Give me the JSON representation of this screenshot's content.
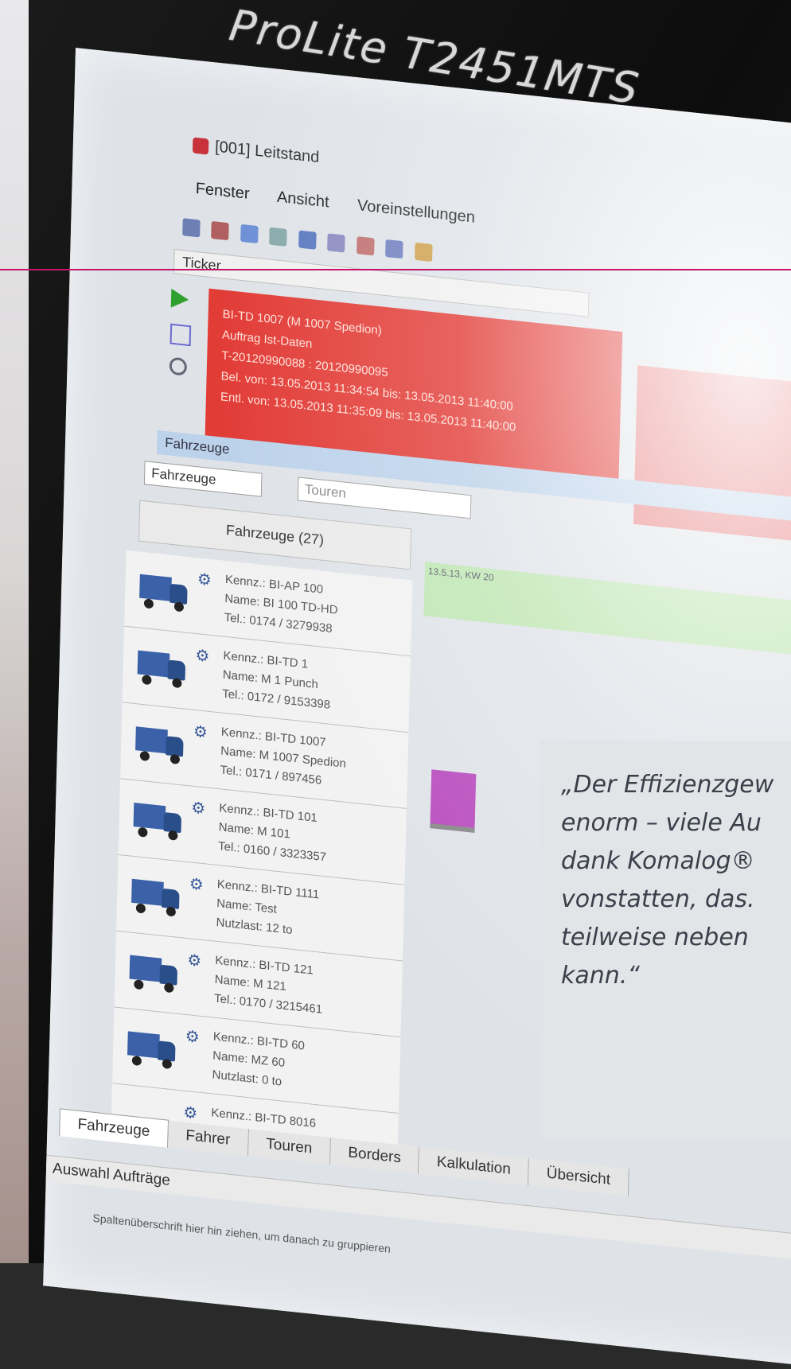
{
  "monitor": {
    "brand": "ProLite T2451MTS"
  },
  "window": {
    "title": "[001] Leitstand"
  },
  "menu": [
    "Fenster",
    "Ansicht",
    "Voreinstellungen"
  ],
  "ticker": {
    "label": "Ticker",
    "alert_lines": [
      "BI-TD 1007 (M 1007 Spedion)",
      "Auftrag Ist-Daten",
      "T-20120990088 : 20120990095",
      "Bel. von: 13.05.2013 11:34:54 bis: 13.05.2013 11:40:00",
      "Entl. von: 13.05.2013 11:35:09 bis: 13.05.2013 11:40:00"
    ]
  },
  "panel": {
    "header": "Fahrzeuge",
    "filter": "Fahrzeuge",
    "tour_combo": "Touren",
    "list_header": "Fahrzeuge (27)",
    "timeline_label": "13.5.13, KW 20"
  },
  "vehicles": [
    {
      "kennz": "Kennz.: BI-AP 100",
      "name": "Name: BI 100 TD-HD",
      "extra": "Tel.: 0174 / 3279938"
    },
    {
      "kennz": "Kennz.: BI-TD 1",
      "name": "Name: M 1 Punch",
      "extra": "Tel.: 0172 / 9153398"
    },
    {
      "kennz": "Kennz.: BI-TD 1007",
      "name": "Name: M 1007 Spedion",
      "extra": "Tel.: 0171 / 897456"
    },
    {
      "kennz": "Kennz.: BI-TD 101",
      "name": "Name: M 101",
      "extra": "Tel.: 0160 / 3323357"
    },
    {
      "kennz": "Kennz.: BI-TD 1111",
      "name": "Name: Test",
      "extra": "Nutzlast: 12 to"
    },
    {
      "kennz": "Kennz.: BI-TD 121",
      "name": "Name: M 121",
      "extra": "Tel.: 0170 / 3215461"
    },
    {
      "kennz": "Kennz.: BI-TD 60",
      "name": "Name: MZ 60",
      "extra": "Nutzlast: 0 to"
    },
    {
      "kennz": "Kennz.: BI-TD 8016",
      "name": "",
      "extra": ""
    }
  ],
  "tabs": [
    "Fahrzeuge",
    "Fahrer",
    "Touren",
    "Borders",
    "Kalkulation",
    "Übersicht"
  ],
  "auswahl": "Auswahl Aufträge",
  "group_hint": "Spaltenüberschrift hier hin ziehen, um danach zu gruppieren",
  "quote": {
    "lines": [
      "„Der Effizienzgew",
      " enorm – viele Au",
      " dank Komalog®",
      " vonstatten, das.",
      " teilweise neben",
      " kann.“"
    ]
  },
  "colors": {
    "ticker_alert": "#e23c37",
    "accent_line": "#c4166b",
    "timeline": "#bfe6b3",
    "quote_box": "#e2e5e8"
  }
}
